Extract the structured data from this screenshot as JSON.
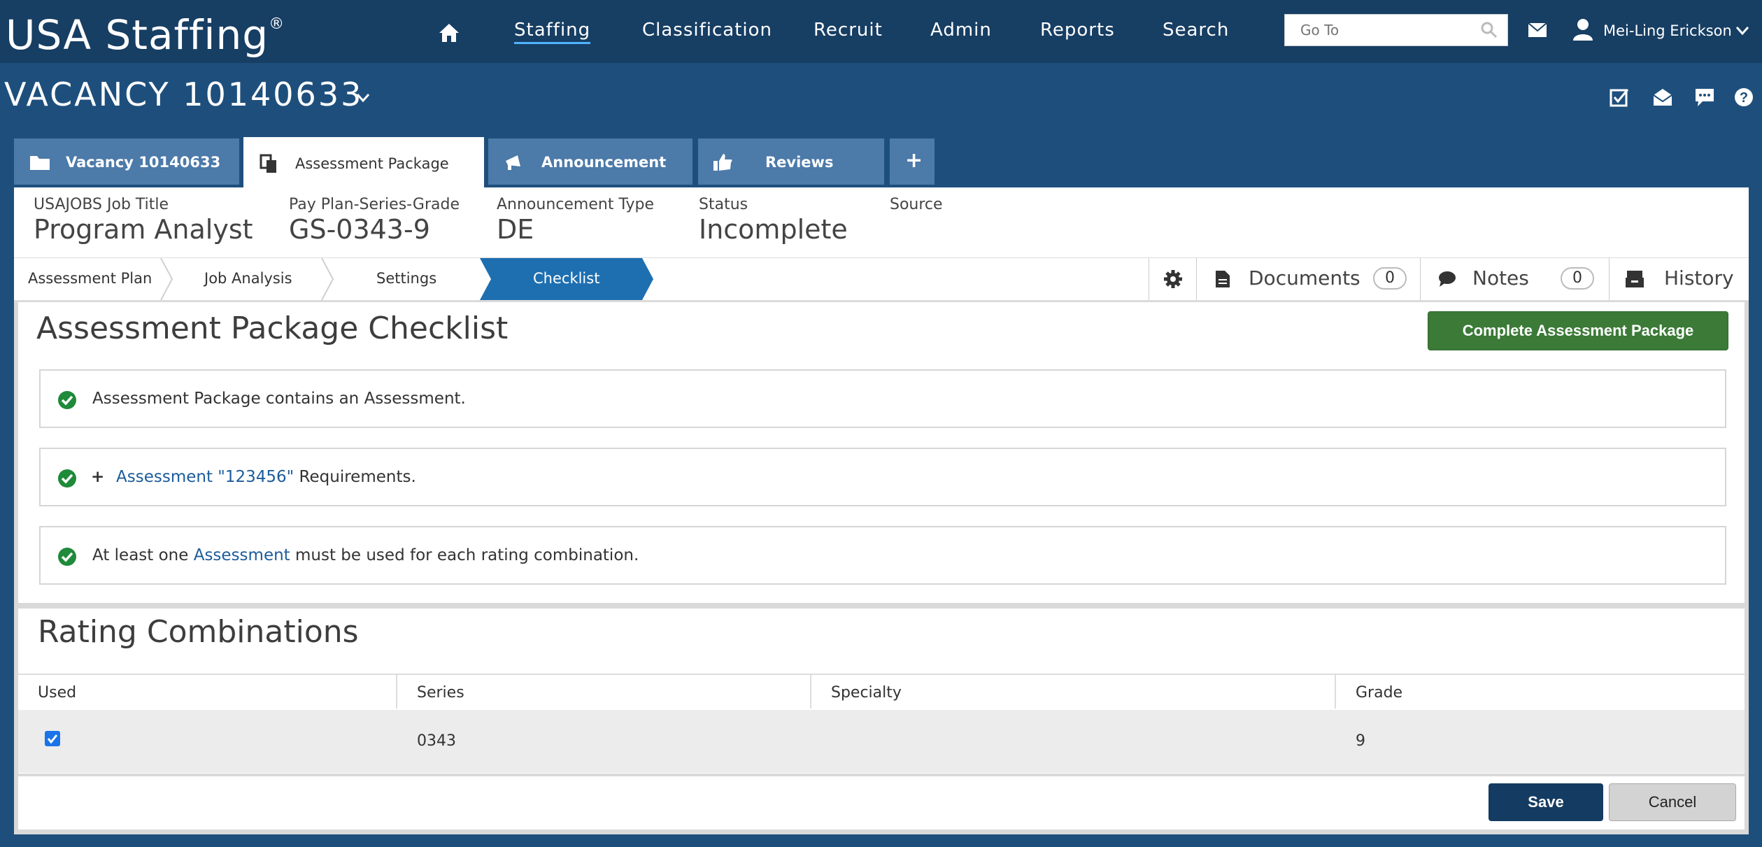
{
  "app": {
    "brand": "USA Staffing",
    "brand_mark": "®"
  },
  "nav": {
    "items": [
      "Staffing",
      "Classification",
      "Recruit",
      "Admin",
      "Reports",
      "Search"
    ],
    "active": "Staffing",
    "goto_placeholder": "Go To",
    "user_name": "Mei-Ling Erickson"
  },
  "vacancy": {
    "title": "VACANCY 10140633"
  },
  "tabs": [
    {
      "label": "Vacancy 10140633",
      "icon": "folder-icon"
    },
    {
      "label": "Assessment Package",
      "icon": "copy-icon",
      "active": true
    },
    {
      "label": "Announcement",
      "icon": "megaphone-icon"
    },
    {
      "label": "Reviews",
      "icon": "thumbs-up-icon"
    },
    {
      "label": "+",
      "icon": "plus-icon"
    }
  ],
  "info": {
    "job_title_label": "USAJOBS Job Title",
    "job_title": "Program Analyst",
    "ppsg_label": "Pay Plan-Series-Grade",
    "ppsg": "GS-0343-9",
    "ann_type_label": "Announcement Type",
    "ann_type": "DE",
    "status_label": "Status",
    "status": "Incomplete",
    "source_label": "Source",
    "source": ""
  },
  "steps": [
    "Assessment Plan",
    "Job Analysis",
    "Settings",
    "Checklist"
  ],
  "side": {
    "documents_label": "Documents",
    "documents_count": "0",
    "notes_label": "Notes",
    "notes_count": "0",
    "history_label": "History"
  },
  "checklist": {
    "title": "Assessment Package Checklist",
    "complete_button": "Complete Assessment Package",
    "item1": "Assessment Package contains an Assessment.",
    "item2_prefix": "+",
    "item2_link": "Assessment \"123456\"",
    "item2_suffix": " Requirements.",
    "item3_prefix": "At least one ",
    "item3_link": "Assessment",
    "item3_suffix": " must be used for each rating combination."
  },
  "rating": {
    "title": "Rating Combinations",
    "headers": [
      "Used",
      "Series",
      "Specialty",
      "Grade"
    ],
    "rows": [
      {
        "used": true,
        "series": "0343",
        "specialty": "",
        "grade": "9"
      }
    ]
  },
  "footer": {
    "save": "Save",
    "cancel": "Cancel"
  },
  "colors": {
    "nav_bg": "#173e63",
    "page_bg": "#1e4f7c",
    "tab_bg": "#4c7aa9",
    "step_active": "#1e6fb0",
    "complete_green": "#3b7a37",
    "ok_green": "#1e8a3a"
  }
}
